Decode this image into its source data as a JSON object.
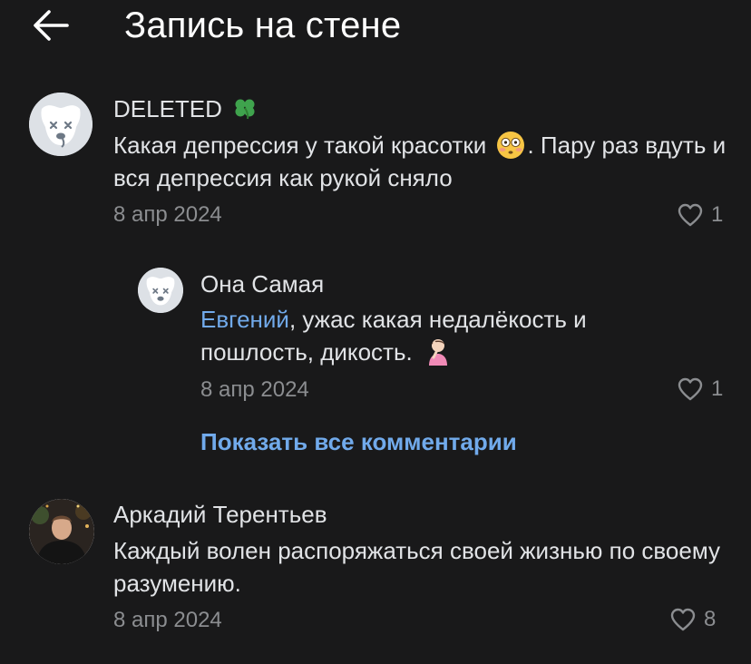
{
  "header": {
    "title": "Запись на стене",
    "back_icon": "arrow-left-icon"
  },
  "comments": [
    {
      "author": "DELETED",
      "author_badge_icon": "clover-icon",
      "text": "Какая депрессия у такой красотки",
      "emoji_icon": "flushed-face-icon",
      "text_after": ". Пару раз вдуть и вся депрессия как рукой сняло",
      "date": "8 апр 2024",
      "likes": "1",
      "avatar_icon": "deleted-dog-avatar-icon"
    },
    {
      "author": "Она Самая",
      "mention": "Евгений",
      "text": ", ужас какая недалёкость и пошлость, дикость.",
      "emoji_icon": "woman-facepalming-icon",
      "date": "8 апр 2024",
      "likes": "1",
      "avatar_icon": "deleted-dog-avatar-icon"
    },
    {
      "author": "Аркадий Терентьев",
      "text": "Каждый волен распоряжаться своей жизнью по своему разумению.",
      "date": "8 апр 2024",
      "likes": "8",
      "avatar_icon": "user-photo-avatar-icon"
    }
  ],
  "show_all_comments": "Показать все комментарии",
  "colors": {
    "background": "#19191a",
    "text": "#e1e3e6",
    "secondary": "#8b8d90",
    "accent": "#71aaeb"
  }
}
